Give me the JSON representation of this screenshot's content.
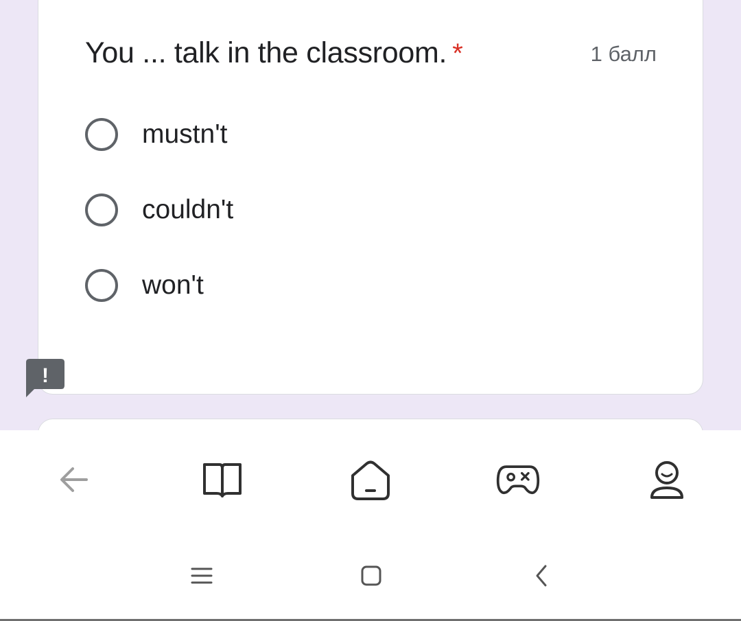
{
  "question": {
    "title": "You ... talk in the classroom.",
    "required_mark": "*",
    "points": "1 балл",
    "options": [
      {
        "label": "mustn't",
        "selected": false
      },
      {
        "label": "couldn't",
        "selected": false
      },
      {
        "label": "won't",
        "selected": false
      }
    ]
  },
  "report_badge": {
    "icon": "exclamation-icon",
    "glyph": "!"
  },
  "app_nav": {
    "items": [
      {
        "name": "back",
        "icon": "arrow-left-icon"
      },
      {
        "name": "library",
        "icon": "open-book-icon"
      },
      {
        "name": "home",
        "icon": "home-icon"
      },
      {
        "name": "games",
        "icon": "gamepad-icon"
      },
      {
        "name": "profile",
        "icon": "user-icon"
      }
    ]
  },
  "system_nav": {
    "items": [
      {
        "name": "recents",
        "icon": "menu-icon"
      },
      {
        "name": "home",
        "icon": "square-icon"
      },
      {
        "name": "back",
        "icon": "chevron-left-icon"
      }
    ]
  },
  "colors": {
    "form_background": "#ede7f6",
    "card": "#ffffff",
    "text": "#202124",
    "secondary_text": "#5f6368",
    "required": "#d93025",
    "badge": "#5f6368"
  }
}
